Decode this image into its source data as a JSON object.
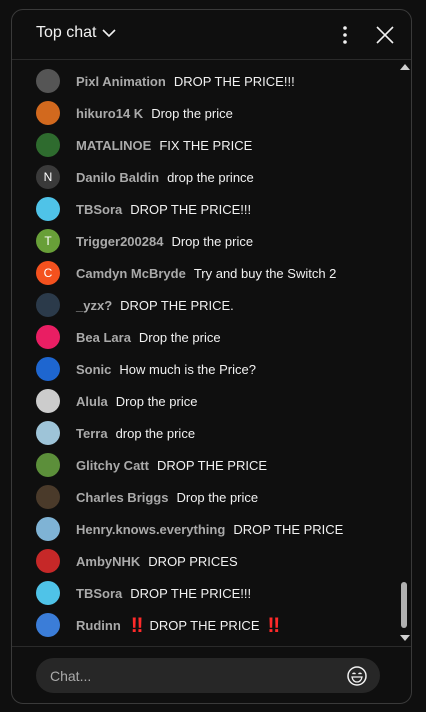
{
  "header": {
    "mode_label": "Top chat"
  },
  "messages": [
    {
      "author": "Pixl Animation",
      "text": "DROP THE PRICE!!!",
      "avatar_color": "#555555",
      "avatar_letter": ""
    },
    {
      "author": "hikuro14 K",
      "text": "Drop the price",
      "avatar_color": "#d2691e",
      "avatar_letter": ""
    },
    {
      "author": "MATALINOE",
      "text": "FIX THE PRICE",
      "avatar_color": "#2e6b2e",
      "avatar_letter": ""
    },
    {
      "author": "Danilo Baldin",
      "text": "drop the prince",
      "avatar_color": "#3a3a3a",
      "avatar_letter": "N"
    },
    {
      "author": "TBSora",
      "text": "DROP THE PRICE!!!",
      "avatar_color": "#4fc3e8",
      "avatar_letter": ""
    },
    {
      "author": "Trigger200284",
      "text": "Drop the price",
      "avatar_color": "#689f38",
      "avatar_letter": "T"
    },
    {
      "author": "Camdyn McBryde",
      "text": "Try and buy the Switch 2",
      "avatar_color": "#f4511e",
      "avatar_letter": "C"
    },
    {
      "author": "_yzx?",
      "text": "DROP THE PRICE.",
      "avatar_color": "#2b3a4a",
      "avatar_letter": ""
    },
    {
      "author": "Bea Lara",
      "text": "Drop the price",
      "avatar_color": "#e91e63",
      "avatar_letter": ""
    },
    {
      "author": "Sonic",
      "text": "How much is the Price?",
      "avatar_color": "#1e66d0",
      "avatar_letter": ""
    },
    {
      "author": "Alula",
      "text": "Drop the price",
      "avatar_color": "#cccccc",
      "avatar_letter": ""
    },
    {
      "author": "Terra",
      "text": "drop the price",
      "avatar_color": "#9ec4d8",
      "avatar_letter": ""
    },
    {
      "author": "Glitchy Catt",
      "text": "DROP THE PRICE",
      "avatar_color": "#5c8f3a",
      "avatar_letter": ""
    },
    {
      "author": "Charles Briggs",
      "text": "Drop the price",
      "avatar_color": "#4a3a2a",
      "avatar_letter": ""
    },
    {
      "author": "Henry.knows.everything",
      "text": "DROP THE PRICE",
      "avatar_color": "#7fb3d5",
      "avatar_letter": ""
    },
    {
      "author": "AmbyNHK",
      "text": "DROP PRICES",
      "avatar_color": "#c62828",
      "avatar_letter": ""
    },
    {
      "author": "TBSora",
      "text": "DROP THE PRICE!!!",
      "avatar_color": "#4fc3e8",
      "avatar_letter": ""
    },
    {
      "author": "Rudinn",
      "text": "DROP THE PRICE",
      "avatar_color": "#3b7dd8",
      "avatar_letter": "",
      "emoji": "‼"
    }
  ],
  "input": {
    "placeholder": "Chat..."
  },
  "colors": {
    "background": "#0f0f0f",
    "author": "#aaaaaa",
    "text": "#f1f1f1",
    "emoji_red": "#ff2a2a"
  }
}
